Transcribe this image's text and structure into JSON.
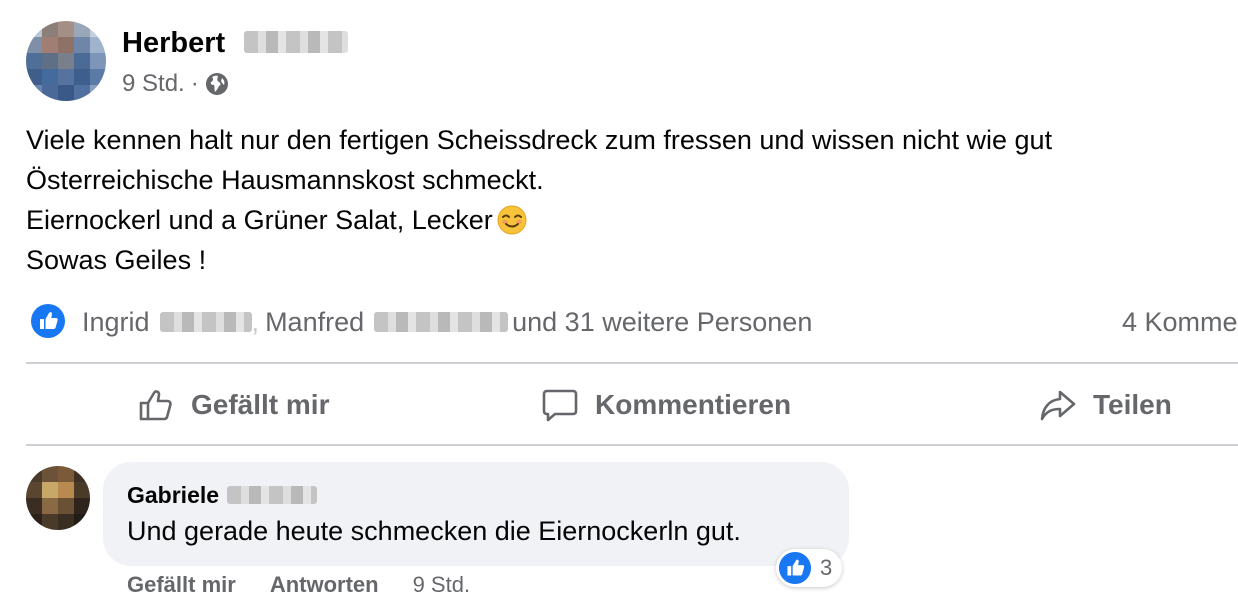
{
  "post": {
    "author_first_name": "Herbert",
    "timestamp": "9 Std.",
    "separator": "·",
    "privacy_icon": "globe-icon",
    "text_lines": [
      "Viele kennen halt nur den fertigen Scheissdreck zum fressen und wissen nicht wie gut",
      "Österreichische Hausmannskost schmeckt.",
      "Eiernockerl und a Grüner Salat, Lecker",
      "Sowas Geiles !"
    ],
    "emoji": "smirking-face-emoji"
  },
  "reactions": {
    "icon": "like-reaction-icon",
    "first_name_1": "Ingrid",
    "separator": ",",
    "first_name_2": "Manfred",
    "others_text": "und 31 weitere Personen",
    "comments_count": "4 Komme"
  },
  "actions": {
    "like_label": "Gefällt mir",
    "comment_label": "Kommentieren",
    "share_label": "Teilen"
  },
  "comment": {
    "author_first_name": "Gabriele",
    "text": "Und gerade heute schmecken die Eiernockerln gut.",
    "reaction_count": "3",
    "like_label": "Gefällt mir",
    "reply_label": "Antworten",
    "timestamp": "9 Std."
  },
  "colors": {
    "text_primary": "#050505",
    "text_secondary": "#65676b",
    "like_blue": "#1877f2",
    "bubble_bg": "#f0f2f5",
    "divider": "#ced0d4"
  }
}
